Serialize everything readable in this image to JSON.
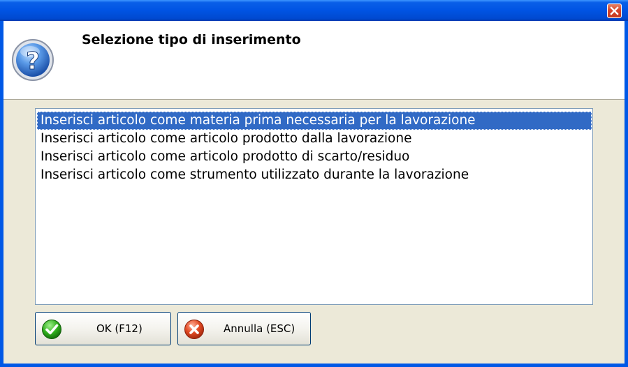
{
  "dialog": {
    "title": "Selezione tipo di inserimento",
    "close_icon": "close-icon",
    "header_icon": "question-mark-icon"
  },
  "list": {
    "items": [
      {
        "label": "Inserisci articolo come materia prima necessaria per la lavorazione",
        "selected": true
      },
      {
        "label": "Inserisci articolo come articolo prodotto dalla lavorazione",
        "selected": false
      },
      {
        "label": "Inserisci articolo come articolo prodotto di scarto/residuo",
        "selected": false
      },
      {
        "label": "Inserisci articolo come strumento utilizzato durante la lavorazione",
        "selected": false
      }
    ]
  },
  "buttons": {
    "ok_label": "OK (F12)",
    "ok_icon": "check-icon",
    "cancel_label": "Annulla (ESC)",
    "cancel_icon": "cancel-icon"
  },
  "colors": {
    "selection": "#316ac5",
    "titlebar": "#0054e3",
    "dialog_bg": "#ece9d8"
  }
}
